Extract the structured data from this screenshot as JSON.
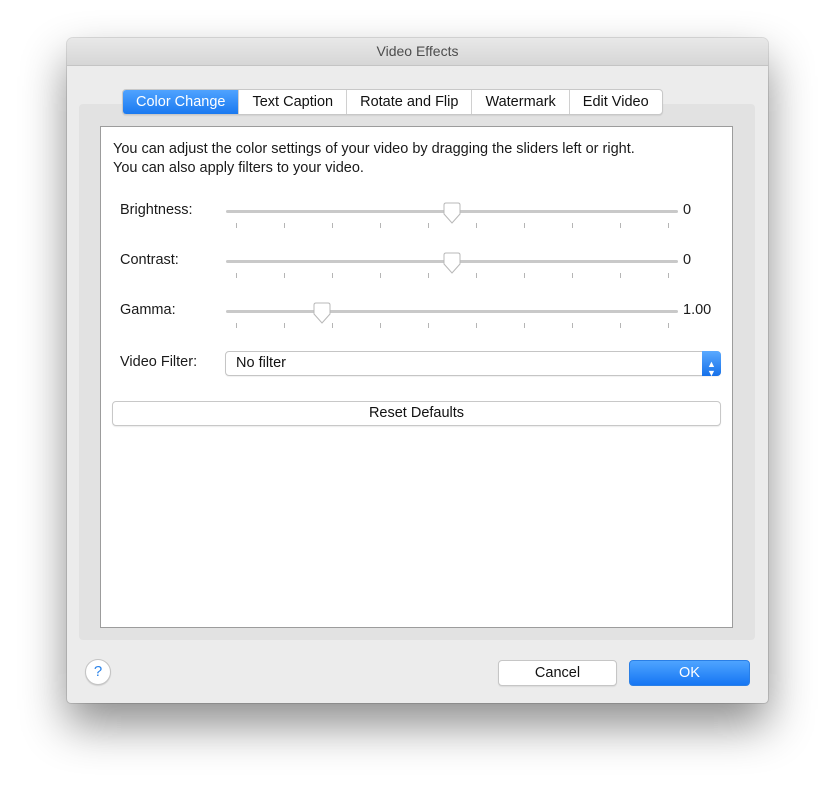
{
  "window": {
    "title": "Video Effects"
  },
  "tabs": [
    {
      "label": "Color Change",
      "active": true
    },
    {
      "label": "Text Caption",
      "active": false
    },
    {
      "label": "Rotate and Flip",
      "active": false
    },
    {
      "label": "Watermark",
      "active": false
    },
    {
      "label": "Edit Video",
      "active": false
    }
  ],
  "panel": {
    "description_line1": "You can adjust the color settings of your video by dragging the sliders left or right.",
    "description_line2": "You can also apply filters to your video.",
    "sliders": [
      {
        "label": "Brightness:",
        "value": "0",
        "position": 0.5,
        "ticks": 10
      },
      {
        "label": "Contrast:",
        "value": "0",
        "position": 0.5,
        "ticks": 10
      },
      {
        "label": "Gamma:",
        "value": "1.00",
        "position": 0.2,
        "ticks": 10
      }
    ],
    "filter": {
      "label": "Video Filter:",
      "selected": "No filter"
    },
    "reset_label": "Reset Defaults"
  },
  "footer": {
    "help_icon": "?",
    "cancel_label": "Cancel",
    "ok_label": "OK"
  },
  "colors": {
    "accent": "#1a79f0"
  }
}
